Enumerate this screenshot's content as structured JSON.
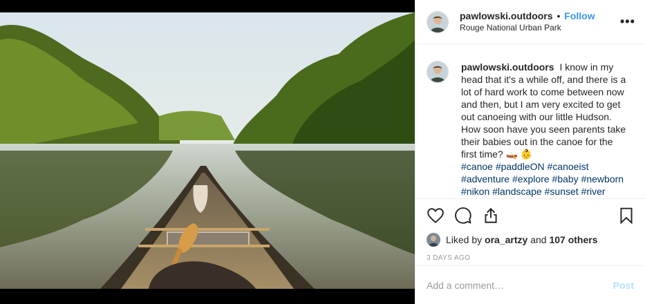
{
  "post": {
    "username": "pawlowski.outdoors",
    "separator": "•",
    "follow_label": "Follow",
    "location": "Rouge National Urban Park",
    "more_label": "•••",
    "caption_username": "pawlowski.outdoors",
    "caption_text": "I know in my head that it's a while off, and there is a lot of hard work to come between now and then, but I am very excited to get out canoeing with our little Hudson. How soon have you seen parents take their babies out in the canoe for the first time? 🛶 👶",
    "hashtags": "#canoe #paddleON #canoeist #adventure #explore #baby #newborn #nikon #landscape #sunset #river",
    "liked_by_prefix": "Liked by",
    "liked_by_user": "ora_artzy",
    "liked_by_and": "and",
    "liked_by_others": "107 others",
    "timestamp": "3 days ago",
    "comment_placeholder": "Add a comment…",
    "post_label": "Post"
  },
  "icons": {
    "heart": "heart-icon",
    "comment": "comment-icon",
    "share": "share-icon",
    "save": "bookmark-icon"
  },
  "colors": {
    "link_blue": "#3897f0",
    "hashtag": "#003569",
    "muted": "#999999",
    "post_disabled": "#b2dffc"
  }
}
